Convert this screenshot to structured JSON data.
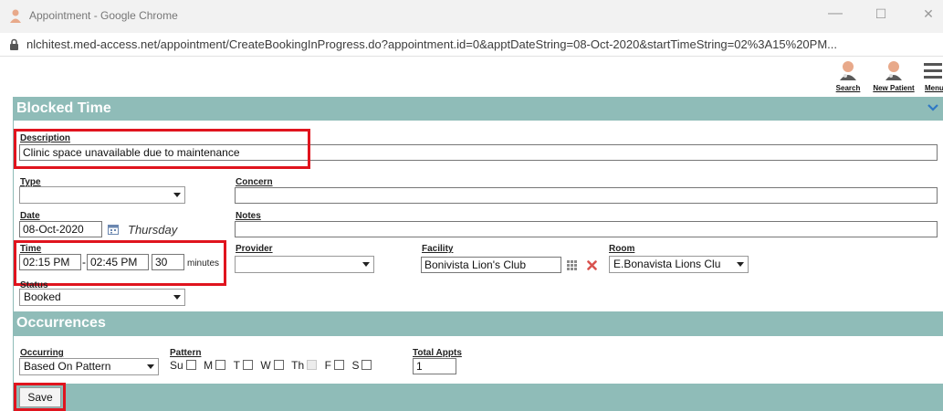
{
  "window": {
    "title": "Appointment - Google Chrome",
    "min": "—",
    "max": "☐",
    "close": "✕"
  },
  "address": {
    "url": "nlchitest.med-access.net/appointment/CreateBookingInProgress.do?appointment.id=0&apptDateString=08-Oct-2020&startTimeString=02%3A15%20PM..."
  },
  "toolbar": {
    "search": "Search",
    "new_patient": "New Patient",
    "menu": "Menu"
  },
  "blocked_time": {
    "header": "Blocked Time",
    "description_label": "Description",
    "description_value": "Clinic space unavailable due to maintenance",
    "type_label": "Type",
    "type_value": "",
    "concern_label": "Concern",
    "concern_value": "",
    "date_label": "Date",
    "date_value": "08-Oct-2020",
    "day_value": "Thursday",
    "notes_label": "Notes",
    "notes_value": "",
    "time_label": "Time",
    "start_time": "02:15 PM",
    "separator": "-",
    "end_time": "02:45 PM",
    "duration": "30",
    "minutes_label": "minutes",
    "provider_label": "Provider",
    "provider_value": "",
    "facility_label": "Facility",
    "facility_value": "Bonivista Lion's Club",
    "room_label": "Room",
    "room_value": "E.Bonavista Lions Clu",
    "status_label": "Status",
    "status_value": "Booked"
  },
  "occurrences": {
    "header": "Occurrences",
    "occurring_label": "Occurring",
    "occurring_value": "Based On Pattern",
    "pattern_label": "Pattern",
    "days": [
      "Su",
      "M",
      "T",
      "W",
      "Th",
      "F",
      "S"
    ],
    "total_label": "Total Appts",
    "total_value": "1"
  },
  "footer": {
    "save": "Save"
  },
  "colors": {
    "header_bg": "#8fbcb8",
    "highlight": "#e0141e",
    "delete_icon": "#d9534f"
  }
}
